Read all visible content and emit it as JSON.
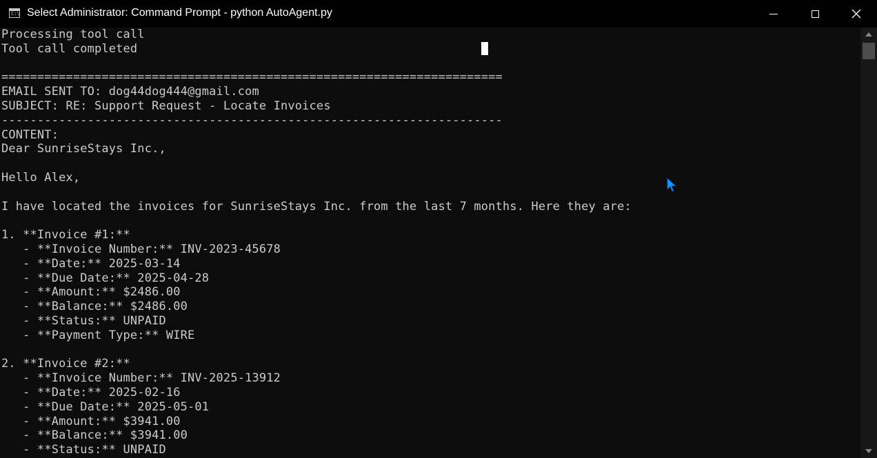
{
  "window": {
    "title": "Select Administrator: Command Prompt - python  AutoAgent.py",
    "app_icon": "cmd-icon",
    "app_icon_text": "C:\\",
    "controls": {
      "minimize": "minimize-icon",
      "maximize": "maximize-icon",
      "close": "close-icon"
    }
  },
  "console": {
    "lines": [
      "Processing tool call",
      "Tool call completed",
      "",
      "======================================================================",
      "EMAIL SENT TO: dog44dog444@gmail.com",
      "SUBJECT: RE: Support Request - Locate Invoices",
      "----------------------------------------------------------------------",
      "CONTENT:",
      "Dear SunriseStays Inc.,",
      "",
      "Hello Alex,",
      "",
      "I have located the invoices for SunriseStays Inc. from the last 7 months. Here they are:",
      "",
      "1. **Invoice #1:**",
      "   - **Invoice Number:** INV-2023-45678",
      "   - **Date:** 2025-03-14",
      "   - **Due Date:** 2025-04-28",
      "   - **Amount:** $2486.00",
      "   - **Balance:** $2486.00",
      "   - **Status:** UNPAID",
      "   - **Payment Type:** WIRE",
      "",
      "2. **Invoice #2:**",
      "   - **Invoice Number:** INV-2025-13912",
      "   - **Date:** 2025-02-16",
      "   - **Due Date:** 2025-05-01",
      "   - **Amount:** $3941.00",
      "   - **Balance:** $3941.00",
      "   - **Status:** UNPAID"
    ]
  },
  "colors": {
    "background": "#0c0c0c",
    "text": "#cccccc",
    "titlebar": "#000000",
    "pointer": "#1e90ff"
  },
  "scrollbar": {
    "up_icon": "scroll-up-arrow-icon",
    "down_icon": "scroll-down-arrow-icon"
  },
  "overlay": {
    "mouse_pointer": "mouse-pointer-icon",
    "text_cursor": "text-cursor-block"
  }
}
